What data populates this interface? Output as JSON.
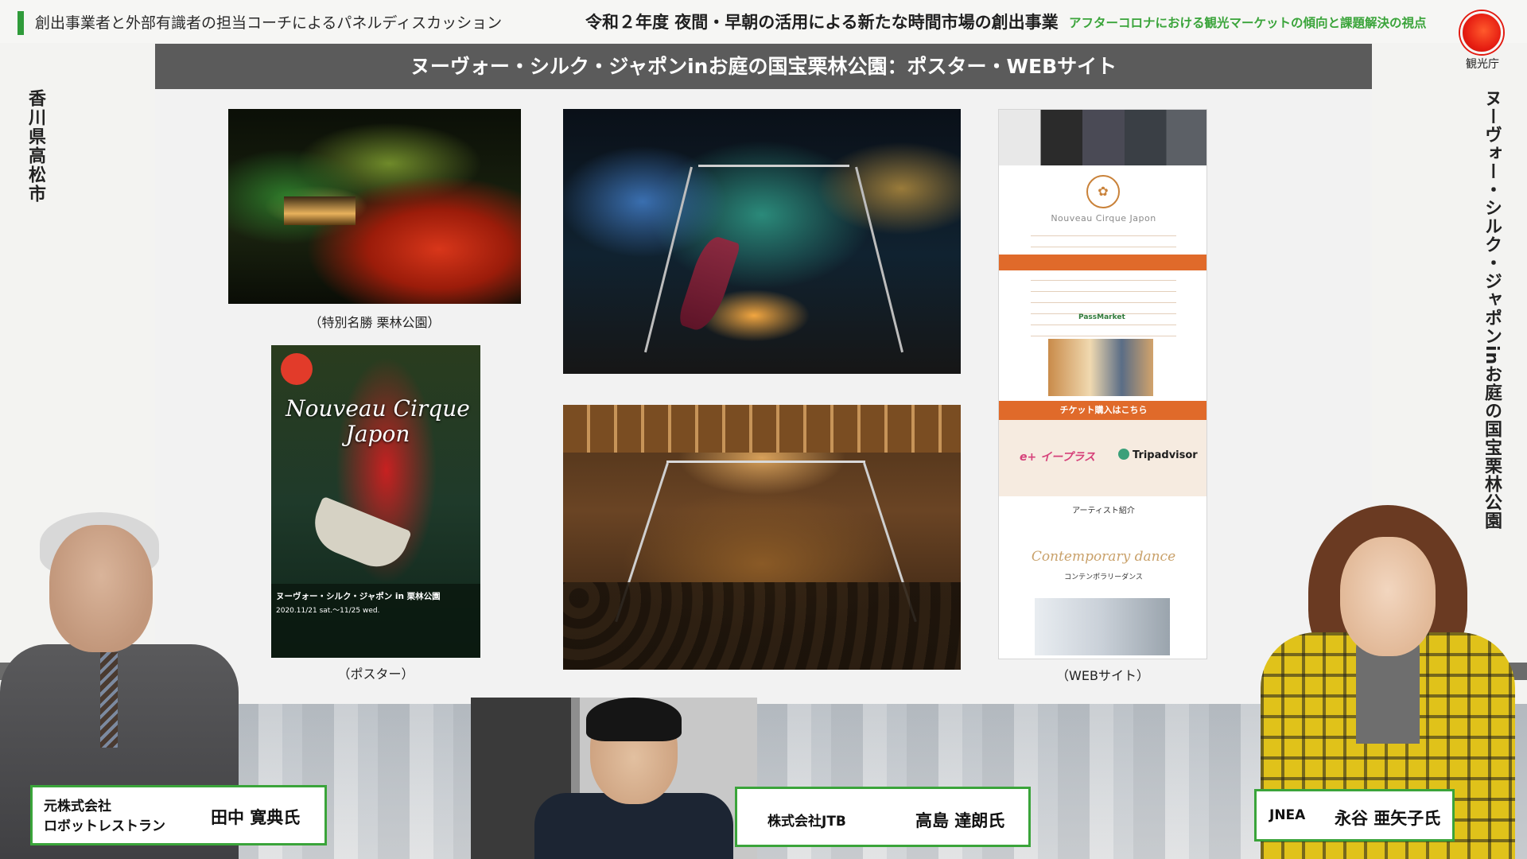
{
  "header": {
    "left_title": "創出事業者と外部有識者の担当コーチによるパネルディスカッション",
    "main_title": "令和２年度 夜間・早朝の活用による新たな時間市場の創出事業",
    "sub_title": "アフターコロナにおける観光マーケットの傾向と課題解決の視点",
    "logo_label": "観光庁",
    "accent_color": "#2f9b3a",
    "subtitle_color": "#3aa43a"
  },
  "side": {
    "left_vertical": "香川県高松市",
    "right_vertical": "ヌーヴォー・シルク・ジャポンinお庭の国宝栗林公園"
  },
  "slide": {
    "title": "ヌーヴォー・シルク・ジャポンinお庭の国宝栗林公園：ポスター・WEBサイト",
    "captions": {
      "park": "（特別名勝 栗林公園）",
      "poster": "（ポスター）",
      "website": "（WEBサイト）"
    },
    "poster": {
      "title": "Nouveau Cirque Japon",
      "headline": "ヌーヴォー・シルク・ジャポン in 栗林公園",
      "dates": "2020.11/21 sat.～11/25 wed."
    },
    "website": {
      "brand": "Nouveau Cirque Japon",
      "pass_market": "PassMarket",
      "ticket_button": "チケット購入はこちら",
      "eplus": "e+ イープラス",
      "tripadvisor": "Tripadvisor",
      "artist_heading": "アーティスト紹介",
      "dance_script": "Contemporary dance",
      "dance_jp": "コンテンポラリーダンス"
    }
  },
  "panelists": [
    {
      "org_line1": "元株式会社",
      "org_line2": "ロボットレストラン",
      "name": "田中 寛典氏"
    },
    {
      "org": "株式会社JTB",
      "name": "高島 達朗氏"
    },
    {
      "org": "JNEA",
      "name": "永谷 亜矢子氏"
    }
  ],
  "colors": {
    "slide_title_bg": "#5b5b5b",
    "nameplate_border": "#3aa43a",
    "website_orange": "#e06a2a"
  }
}
